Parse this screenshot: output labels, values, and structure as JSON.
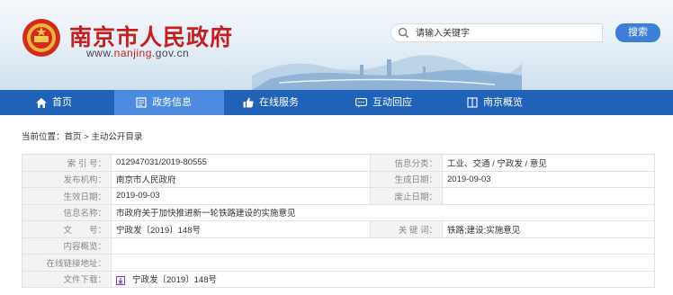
{
  "header": {
    "site_name": "南京市人民政府",
    "domain_pre": "www.",
    "domain_hl": "nanjing",
    "domain_post": ".gov.cn",
    "search_placeholder": "请输入关键字",
    "search_button": "搜索"
  },
  "nav": {
    "items": [
      {
        "label": "首页",
        "icon": "home-icon"
      },
      {
        "label": "政务信息",
        "icon": "document-icon"
      },
      {
        "label": "在线服务",
        "icon": "thumbs-up-icon"
      },
      {
        "label": "互动回应",
        "icon": "chat-icon"
      },
      {
        "label": "南京概览",
        "icon": "book-icon"
      }
    ]
  },
  "breadcrumb": "当前位置：首页 > 主动公开目录",
  "info_table": {
    "index_label": "索 引 号：",
    "index_value": "012947031/2019-80555",
    "category_label": "信息分类：",
    "category_value": "工业、交通 / 宁政发 / 意见",
    "publisher_label": "发布机构：",
    "publisher_value": "南京市人民政府",
    "created_label": "生成日期：",
    "created_value": "2019-09-03",
    "effective_label": "生效日期：",
    "effective_value": "2019-09-03",
    "repeal_label": "废止日期：",
    "repeal_value": "",
    "title_label": "信息名称：",
    "title_value": "市政府关于加快推进新一轮铁路建设的实施意见",
    "docno_label": "文　　号：",
    "docno_value": "宁政发〔2019〕148号",
    "keywords_label": "关 键 词：",
    "keywords_value": "铁路;建设;实施意见",
    "summary_label": "内容概览：",
    "summary_value": "",
    "link_label": "在线链接地址：",
    "link_value": "",
    "download_label": "文件下载：",
    "download_value": "宁政发〔2019〕148号"
  },
  "colors": {
    "brand_red": "#c81e1e",
    "nav_blue": "#1f62b8",
    "nav_active": "#4c8be0",
    "search_button": "#3d7fd6"
  }
}
